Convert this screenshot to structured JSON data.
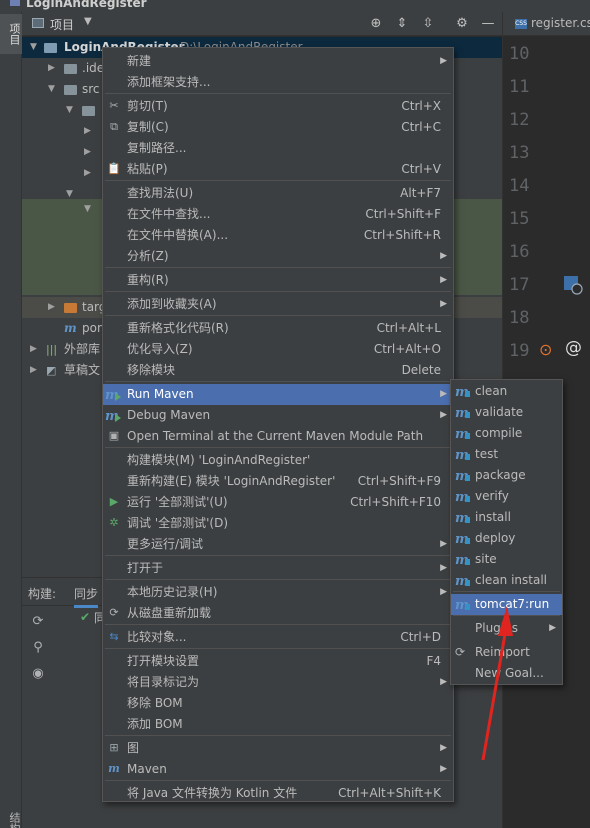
{
  "window": {
    "title": "LoginAndRegister"
  },
  "left_strip": {
    "project_tab": "项目",
    "structure_tab": "结构"
  },
  "project_panel": {
    "title": "项目",
    "tree": {
      "root_label": "LoginAndRegister",
      "root_path": "D:\\LoginAndRegister",
      "idea": ".ide",
      "src": "src",
      "target": "targ",
      "pom": "pom",
      "external_libs": "外部库",
      "scratches": "草稿文"
    }
  },
  "editor": {
    "tab_label": "register.css",
    "line_numbers": [
      "10",
      "11",
      "12",
      "13",
      "14",
      "15",
      "16",
      "17",
      "18",
      "19"
    ]
  },
  "build_panel": {
    "tab_build": "构建:",
    "tab_sync": "同步",
    "row_text": "同"
  },
  "context_menu": {
    "items": [
      {
        "label": "新建",
        "shortcut": "",
        "submenu": true,
        "icon": ""
      },
      {
        "label": "添加框架支持...",
        "shortcut": "",
        "submenu": false,
        "icon": ""
      },
      {
        "label": "剪切(T)",
        "shortcut": "Ctrl+X",
        "submenu": false,
        "icon": "scissors-icon"
      },
      {
        "label": "复制(C)",
        "shortcut": "Ctrl+C",
        "submenu": false,
        "icon": "copy-icon"
      },
      {
        "label": "复制路径...",
        "shortcut": "",
        "submenu": false,
        "icon": ""
      },
      {
        "label": "粘贴(P)",
        "shortcut": "Ctrl+V",
        "submenu": false,
        "icon": "paste-icon"
      },
      {
        "label": "查找用法(U)",
        "shortcut": "Alt+F7",
        "submenu": false,
        "icon": ""
      },
      {
        "label": "在文件中查找...",
        "shortcut": "Ctrl+Shift+F",
        "submenu": false,
        "icon": ""
      },
      {
        "label": "在文件中替换(A)...",
        "shortcut": "Ctrl+Shift+R",
        "submenu": false,
        "icon": ""
      },
      {
        "label": "分析(Z)",
        "shortcut": "",
        "submenu": true,
        "icon": ""
      },
      {
        "label": "重构(R)",
        "shortcut": "",
        "submenu": true,
        "icon": ""
      },
      {
        "label": "添加到收藏夹(A)",
        "shortcut": "",
        "submenu": true,
        "icon": ""
      },
      {
        "label": "重新格式化代码(R)",
        "shortcut": "Ctrl+Alt+L",
        "submenu": false,
        "icon": ""
      },
      {
        "label": "优化导入(Z)",
        "shortcut": "Ctrl+Alt+O",
        "submenu": false,
        "icon": ""
      },
      {
        "label": "移除模块",
        "shortcut": "Delete",
        "submenu": false,
        "icon": ""
      },
      {
        "label": "Run Maven",
        "shortcut": "",
        "submenu": true,
        "icon": "maven-run-icon"
      },
      {
        "label": "Debug Maven",
        "shortcut": "",
        "submenu": true,
        "icon": "maven-debug-icon"
      },
      {
        "label": "Open Terminal at the Current Maven Module Path",
        "shortcut": "",
        "submenu": false,
        "icon": "terminal-icon"
      },
      {
        "label": "构建模块(M) 'LoginAndRegister'",
        "shortcut": "",
        "submenu": false,
        "icon": ""
      },
      {
        "label": "重新构建(E) 模块 'LoginAndRegister'",
        "shortcut": "Ctrl+Shift+F9",
        "submenu": false,
        "icon": ""
      },
      {
        "label": "运行 '全部测试'(U)",
        "shortcut": "Ctrl+Shift+F10",
        "submenu": false,
        "icon": "run-icon"
      },
      {
        "label": "调试 '全部测试'(D)",
        "shortcut": "",
        "submenu": false,
        "icon": "debug-icon"
      },
      {
        "label": "更多运行/调试",
        "shortcut": "",
        "submenu": true,
        "icon": ""
      },
      {
        "label": "打开于",
        "shortcut": "",
        "submenu": true,
        "icon": ""
      },
      {
        "label": "本地历史记录(H)",
        "shortcut": "",
        "submenu": true,
        "icon": ""
      },
      {
        "label": "从磁盘重新加载",
        "shortcut": "",
        "submenu": false,
        "icon": "reload-icon"
      },
      {
        "label": "比较对象...",
        "shortcut": "Ctrl+D",
        "submenu": false,
        "icon": "compare-icon"
      },
      {
        "label": "打开模块设置",
        "shortcut": "F4",
        "submenu": false,
        "icon": ""
      },
      {
        "label": "将目录标记为",
        "shortcut": "",
        "submenu": true,
        "icon": ""
      },
      {
        "label": "移除 BOM",
        "shortcut": "",
        "submenu": false,
        "icon": ""
      },
      {
        "label": "添加 BOM",
        "shortcut": "",
        "submenu": false,
        "icon": ""
      },
      {
        "label": "图",
        "shortcut": "",
        "submenu": true,
        "icon": "diagram-icon"
      },
      {
        "label": "Maven",
        "shortcut": "",
        "submenu": true,
        "icon": "maven-icon"
      },
      {
        "label": "将 Java 文件转换为 Kotlin 文件",
        "shortcut": "Ctrl+Alt+Shift+K",
        "submenu": false,
        "icon": ""
      }
    ]
  },
  "run_maven_submenu": {
    "items": [
      {
        "label": "clean",
        "submenu": false
      },
      {
        "label": "validate",
        "submenu": false
      },
      {
        "label": "compile",
        "submenu": false
      },
      {
        "label": "test",
        "submenu": false
      },
      {
        "label": "package",
        "submenu": false
      },
      {
        "label": "verify",
        "submenu": false
      },
      {
        "label": "install",
        "submenu": false
      },
      {
        "label": "deploy",
        "submenu": false
      },
      {
        "label": "site",
        "submenu": false
      },
      {
        "label": "clean install",
        "submenu": false
      },
      {
        "label": "tomcat7:run",
        "submenu": false
      },
      {
        "label": "Plugins",
        "submenu": true
      },
      {
        "label": "Reimport",
        "submenu": false
      },
      {
        "label": "New Goal...",
        "submenu": false
      }
    ]
  },
  "colors": {
    "accent": "#4b6eaf",
    "annotation": "#e0241f",
    "maven": "#5f94c8"
  }
}
